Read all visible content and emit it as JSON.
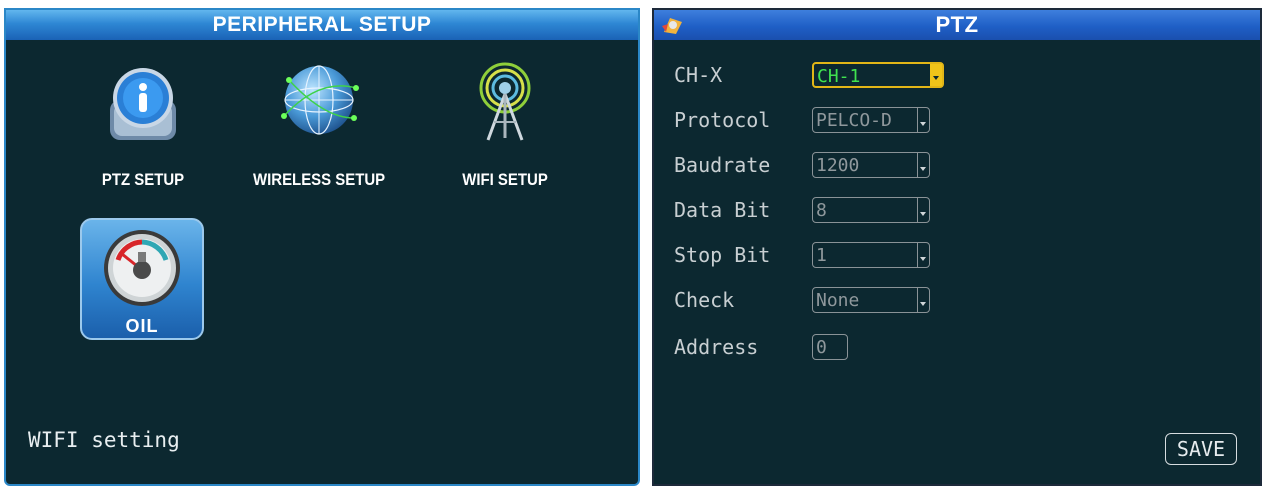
{
  "left_panel": {
    "title": "PERIPHERAL  SETUP",
    "tiles": [
      {
        "label": "PTZ SETUP",
        "icon": "ptz-icon"
      },
      {
        "label": "WIRELESS SETUP",
        "icon": "globe-icon"
      },
      {
        "label": "WIFI  SETUP",
        "icon": "antenna-icon"
      },
      {
        "label": "OIL",
        "icon": "fuel-gauge-icon",
        "selected": true
      }
    ],
    "status_text": "WIFI setting"
  },
  "right_panel": {
    "title": "PTZ",
    "fields": [
      {
        "label": "CH-X",
        "value": "CH-1",
        "active": true
      },
      {
        "label": "Protocol",
        "value": "PELCO-D"
      },
      {
        "label": "Baudrate",
        "value": "1200"
      },
      {
        "label": "Data Bit",
        "value": "8"
      },
      {
        "label": "Stop Bit",
        "value": "1"
      },
      {
        "label": "Check",
        "value": "None"
      },
      {
        "label": "Address",
        "value": "0"
      }
    ],
    "save_label": "SAVE"
  },
  "colors": {
    "panel_bg": "#0c2830",
    "title_blue": "#2e87d4",
    "active_border": "#e2b617",
    "active_text": "#3fe24f"
  }
}
